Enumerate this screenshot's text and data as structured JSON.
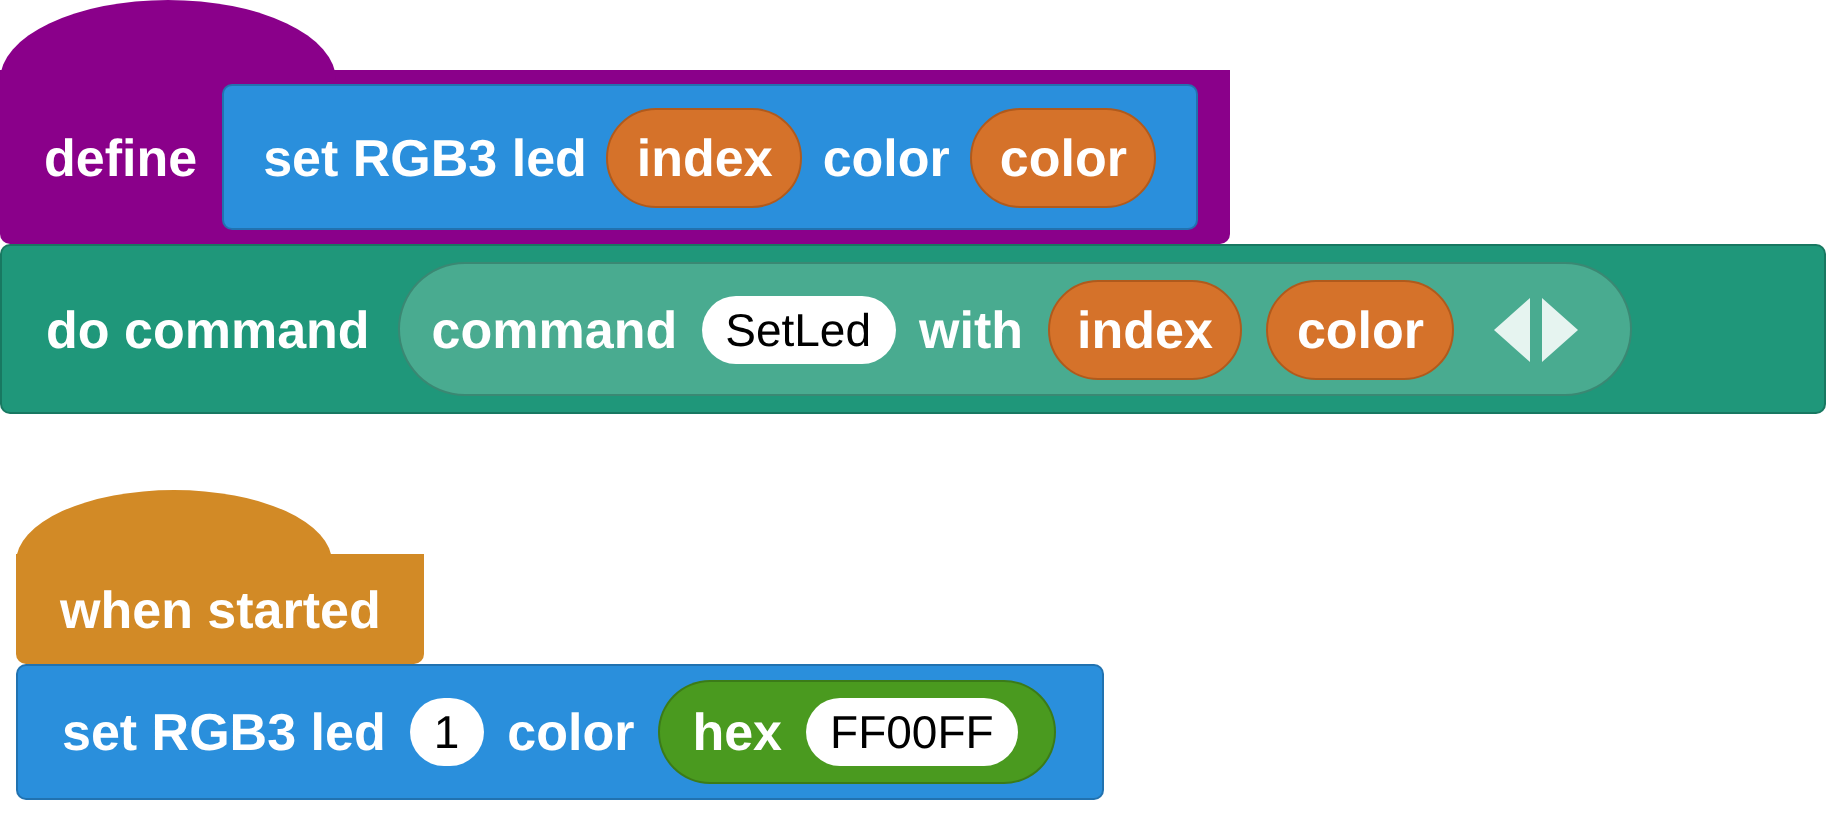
{
  "scripts": [
    {
      "blocks": [
        {
          "kind": "define_hat",
          "color": "#8a008a",
          "parts": [
            {
              "kind": "label",
              "text": "define"
            },
            {
              "kind": "prototype",
              "color": "#2a8fdc",
              "parts": [
                {
                  "kind": "label",
                  "text": "set RGB3 led"
                },
                {
                  "kind": "param",
                  "text": "index"
                },
                {
                  "kind": "label",
                  "text": "color"
                },
                {
                  "kind": "param",
                  "text": "color"
                }
              ]
            }
          ]
        },
        {
          "kind": "stack",
          "color": "#1f977a",
          "parts": [
            {
              "kind": "label",
              "text": "do command"
            },
            {
              "kind": "reporter",
              "color": "#49ab90",
              "parts": [
                {
                  "kind": "label",
                  "text": "command"
                },
                {
                  "kind": "text_input",
                  "value": "SetLed"
                },
                {
                  "kind": "label",
                  "text": "with"
                },
                {
                  "kind": "param",
                  "text": "index"
                },
                {
                  "kind": "param",
                  "text": "color"
                },
                {
                  "kind": "arrows"
                }
              ]
            }
          ]
        }
      ]
    },
    {
      "blocks": [
        {
          "kind": "event_hat",
          "color": "#d28a26",
          "parts": [
            {
              "kind": "label",
              "text": "when started"
            }
          ]
        },
        {
          "kind": "stack",
          "color": "#2a8fdc",
          "parts": [
            {
              "kind": "label",
              "text": "set RGB3 led"
            },
            {
              "kind": "text_input",
              "value": "1"
            },
            {
              "kind": "label",
              "text": "color"
            },
            {
              "kind": "reporter",
              "color": "#4a9a1f",
              "parts": [
                {
                  "kind": "label",
                  "text": "hex"
                },
                {
                  "kind": "text_input",
                  "value": "FF00FF"
                }
              ]
            }
          ]
        }
      ]
    }
  ]
}
